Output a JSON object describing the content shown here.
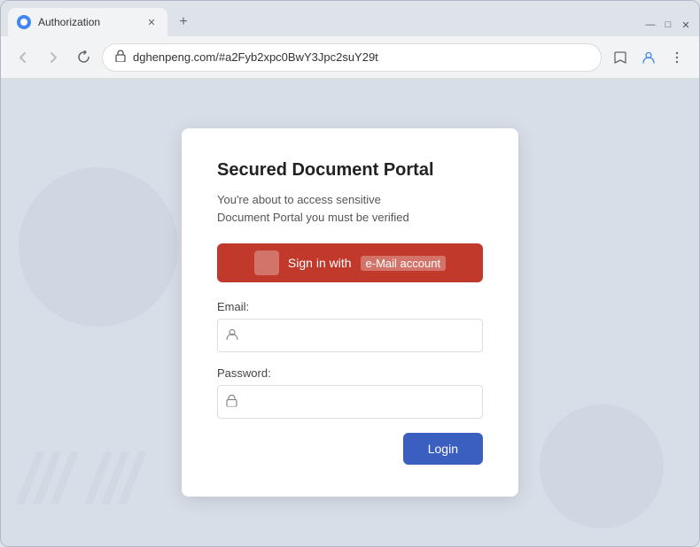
{
  "browser": {
    "tab_title": "Authorization",
    "url": "dghenpeng.com/#a2Fyb2xpc0BwY3Jpc2suY29t",
    "nav": {
      "back": "‹",
      "forward": "›",
      "reload": "↺"
    },
    "window_controls": {
      "minimize": "—",
      "maximize": "□",
      "close": "✕"
    },
    "new_tab": "+"
  },
  "card": {
    "title": "Secured Document Portal",
    "subtitle_line1": "You're about to access sensitive",
    "subtitle_line2": "Document Portal you must be verified",
    "sign_in_button": "Sign in with",
    "sign_in_brand": "e-Mail account",
    "email_label": "Email:",
    "email_placeholder": "",
    "password_label": "Password:",
    "password_placeholder": "",
    "login_button": "Login"
  },
  "colors": {
    "sign_in_bg": "#c0392b",
    "login_bg": "#3b5fc0",
    "card_bg": "#ffffff",
    "page_bg": "#d8dee8"
  }
}
